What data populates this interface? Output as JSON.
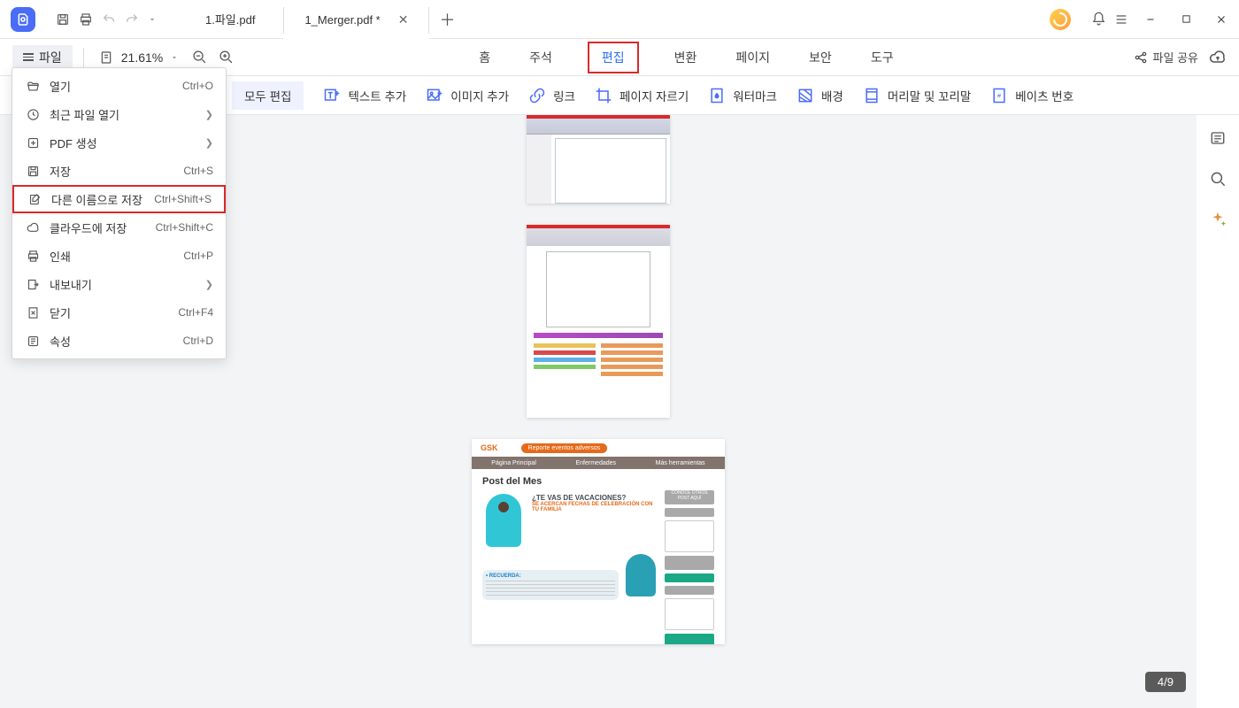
{
  "tabs": {
    "inactive": "1.파일.pdf",
    "active": "1_Merger.pdf *"
  },
  "file_btn": "파일",
  "zoom": "21.61%",
  "main_tabs": {
    "home": "홈",
    "annot": "주석",
    "edit": "편집",
    "convert": "변환",
    "page": "페이지",
    "security": "보안",
    "tools": "도구"
  },
  "share": "파일 공유",
  "toolbar": {
    "edit_all": "모두 편집",
    "add_text": "텍스트 추가",
    "add_image": "이미지 추가",
    "link": "링크",
    "crop": "페이지 자르기",
    "watermark": "워터마크",
    "background": "배경",
    "header_footer": "머리말 및 꼬리말",
    "bates": "베이츠 번호"
  },
  "menu": {
    "open": {
      "label": "열기",
      "shortcut": "Ctrl+O"
    },
    "recent": {
      "label": "최근 파일 열기"
    },
    "create": {
      "label": "PDF 생성"
    },
    "save": {
      "label": "저장",
      "shortcut": "Ctrl+S"
    },
    "save_as": {
      "label": "다른 이름으로 저장",
      "shortcut": "Ctrl+Shift+S"
    },
    "save_cloud": {
      "label": "클라우드에 저장",
      "shortcut": "Ctrl+Shift+C"
    },
    "print": {
      "label": "인쇄",
      "shortcut": "Ctrl+P"
    },
    "export": {
      "label": "내보내기"
    },
    "close": {
      "label": "닫기",
      "shortcut": "Ctrl+F4"
    },
    "props": {
      "label": "속성",
      "shortcut": "Ctrl+D"
    }
  },
  "page3": {
    "logo": "GSK",
    "pill": "Reporte eventos adversos",
    "nav1": "Página Principal",
    "nav2": "Enfermedades",
    "nav3": "Más herramientas",
    "heading": "Post del Mes",
    "vac_t": "¿TE VAS DE VACACIONES?",
    "vac_s": "SE ACERCAN FECHAS DE CELEBRACIÓN CON TU FAMILIA",
    "bubble_t": "• RECUERDA:"
  },
  "page_indicator": "4/9"
}
